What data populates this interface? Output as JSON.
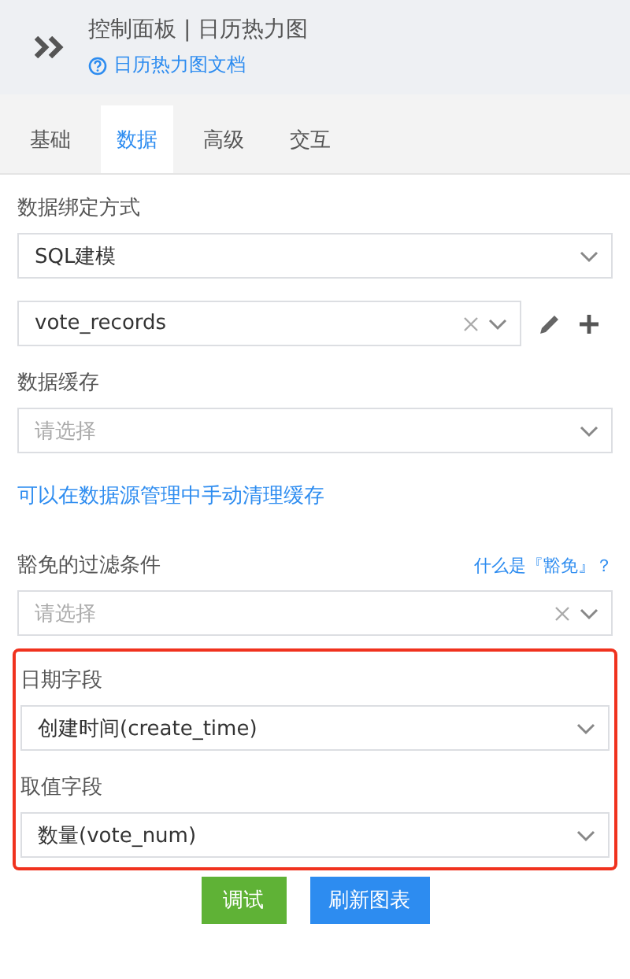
{
  "header": {
    "title": "控制面板 | 日历热力图",
    "doc_link": "日历热力图文档"
  },
  "tabs": [
    {
      "label": "基础",
      "selected": false
    },
    {
      "label": "数据",
      "selected": true
    },
    {
      "label": "高级",
      "selected": false
    },
    {
      "label": "交互",
      "selected": false
    }
  ],
  "sections": [
    {
      "kind": "field",
      "label": "数据绑定方式",
      "select": {
        "value": "SQL建模",
        "clearable": false
      }
    },
    {
      "kind": "field",
      "select": {
        "value": "vote_records",
        "clearable": true
      },
      "actions": true
    },
    {
      "kind": "field",
      "label": "数据缓存",
      "select": {
        "placeholder": "请选择",
        "clearable": false
      }
    },
    {
      "kind": "note",
      "text": "可以在数据源管理中手动清理缓存"
    },
    {
      "kind": "field",
      "label": "豁免的过滤条件",
      "help_link": "什么是『豁免』？",
      "select": {
        "placeholder": "请选择",
        "clearable": true
      }
    }
  ],
  "highlighted_group": {
    "highlighted": true,
    "fields": [
      {
        "label": "日期字段",
        "select": {
          "value": "创建时间(create_time)",
          "clearable": false
        }
      },
      {
        "label": "取值字段",
        "select": {
          "value": "数量(vote_num)",
          "clearable": false
        }
      }
    ]
  },
  "buttons": [
    {
      "label": "调试",
      "kind": "success"
    },
    {
      "label": "刷新图表",
      "kind": "primary"
    }
  ]
}
